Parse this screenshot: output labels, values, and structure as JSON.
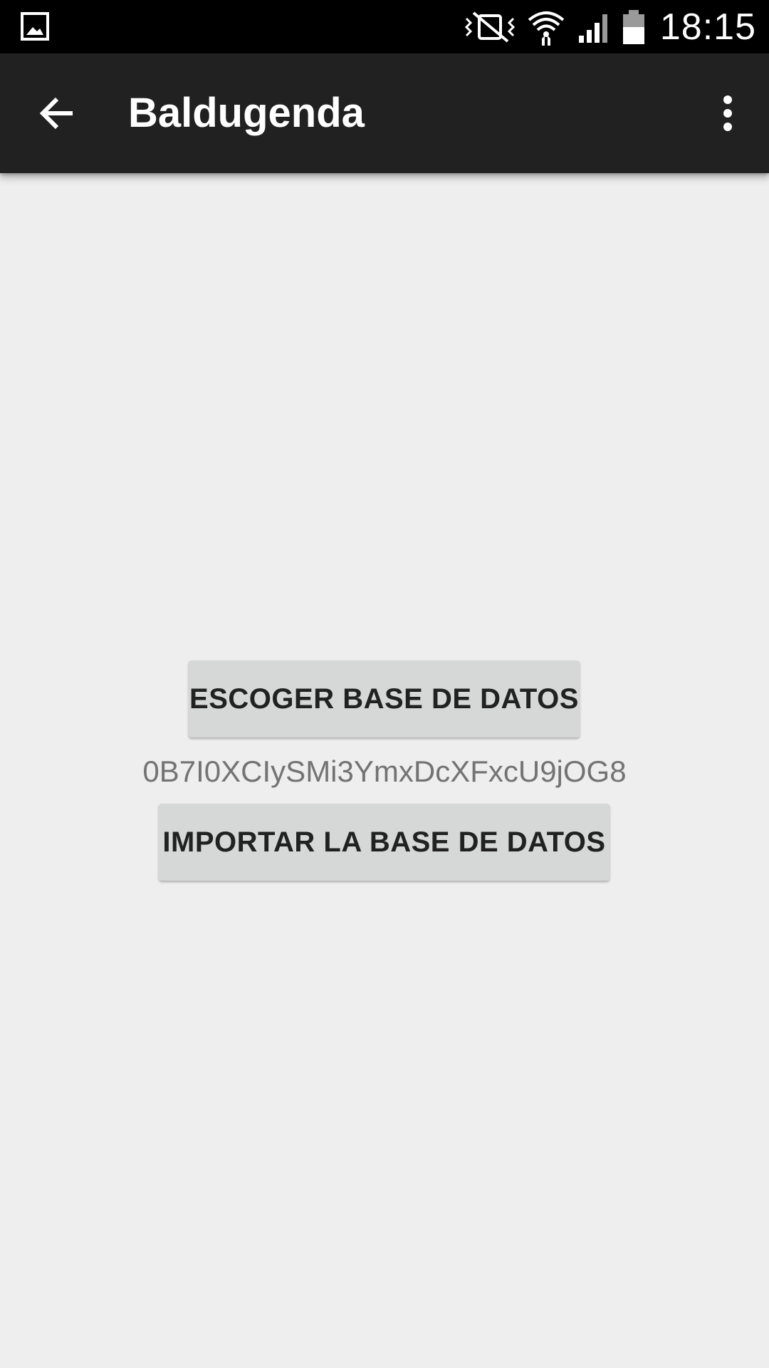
{
  "status_bar": {
    "time": "18:15",
    "icons": [
      "gallery-notification-icon",
      "vibrate-off-icon",
      "wifi-icon",
      "cell-signal-icon",
      "battery-icon"
    ],
    "background_color": "#000000"
  },
  "toolbar": {
    "title": "Baldugenda",
    "back_icon": "arrow-left-icon",
    "overflow_icon": "more-vert-icon",
    "background_color": "#212121"
  },
  "main": {
    "choose_db_button": "ESCOGER BASE DE DATOS",
    "db_id": "0B7I0XCIySMi3YmxDcXFxcU9jOG8",
    "import_db_button": "IMPORTAR LA BASE DE DATOS",
    "background_color": "#eeeeee",
    "button_color": "#d6d7d7"
  }
}
